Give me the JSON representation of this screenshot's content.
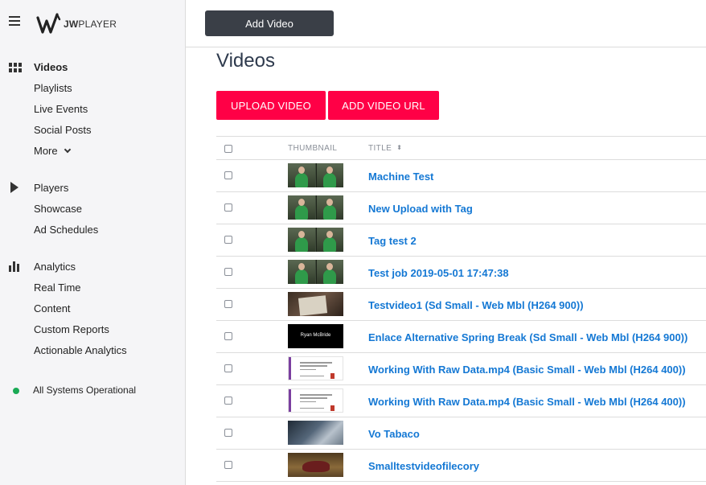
{
  "brand": {
    "name_bold": "JW",
    "name_light": "PLAYER"
  },
  "sidebar": {
    "sections": [
      {
        "icon": "grid-icon",
        "items": [
          {
            "label": "Videos",
            "active": true
          },
          {
            "label": "Playlists"
          },
          {
            "label": "Live Events"
          },
          {
            "label": "Social Posts"
          },
          {
            "label": "More"
          }
        ]
      },
      {
        "icon": "play-icon",
        "items": [
          {
            "label": "Players"
          },
          {
            "label": "Showcase"
          },
          {
            "label": "Ad Schedules"
          }
        ]
      },
      {
        "icon": "bar-chart-icon",
        "items": [
          {
            "label": "Analytics"
          },
          {
            "label": "Real Time"
          },
          {
            "label": "Content"
          },
          {
            "label": "Custom Reports"
          },
          {
            "label": "Actionable Analytics"
          }
        ]
      }
    ],
    "status": {
      "text": "All Systems Operational",
      "color": "#1aaa55"
    }
  },
  "topbar": {
    "add_video_label": "Add Video"
  },
  "main": {
    "title": "Videos",
    "upload_label": "UPLOAD VIDEO",
    "add_url_label": "ADD VIDEO URL",
    "columns": {
      "thumbnail": "THUMBNAIL",
      "title": "TITLE"
    },
    "rows": [
      {
        "title": "Machine Test",
        "thumb": "green"
      },
      {
        "title": "New Upload with Tag",
        "thumb": "green"
      },
      {
        "title": "Tag test 2",
        "thumb": "green"
      },
      {
        "title": "Test job 2019-05-01 17:47:38",
        "thumb": "green"
      },
      {
        "title": "Testvideo1 (Sd Small - Web Mbl (H264 900))",
        "thumb": "paper"
      },
      {
        "title": "Enlace Alternative Spring Break (Sd Small - Web Mbl (H264 900))",
        "thumb": "black",
        "thumb_text": "Ryan McBride"
      },
      {
        "title": "Working With Raw Data.mp4 (Basic Small - Web Mbl (H264 400))",
        "thumb": "slide"
      },
      {
        "title": "Working With Raw Data.mp4 (Basic Small - Web Mbl (H264 400))",
        "thumb": "slide"
      },
      {
        "title": "Vo Tabaco",
        "thumb": "doc"
      },
      {
        "title": "Smalltestvideofilecory",
        "thumb": "shoe"
      }
    ]
  },
  "colors": {
    "accent": "#ff0046",
    "link": "#1478d4",
    "dark_button": "#3a3f47"
  }
}
